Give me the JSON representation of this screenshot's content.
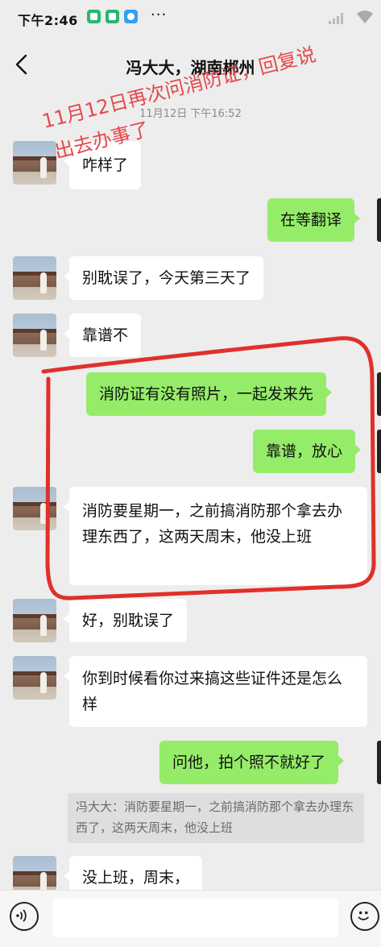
{
  "status_bar": {
    "time": "下午2:46",
    "more": "···"
  },
  "header": {
    "title": "冯大大，湖南郴州",
    "back_icon": "chevron-left-icon"
  },
  "timestamp": "11月12日 下午16:52",
  "annotation": {
    "line1": "11月12日再次问消防证，回复说",
    "line2": "出去办事了",
    "color": "#e5484d"
  },
  "messages": [
    {
      "side": "in",
      "text": "咋样了"
    },
    {
      "side": "out",
      "text": "在等翻译"
    },
    {
      "side": "in",
      "text": "别耽误了，今天第三天了"
    },
    {
      "side": "in",
      "text": "靠谱不"
    },
    {
      "side": "out",
      "text": "消防证有没有照片，一起发来先"
    },
    {
      "side": "out",
      "text": "靠谱，放心"
    },
    {
      "side": "in",
      "text": "消防要星期一，之前搞消防那个拿去办理东西了，这两天周末，他没上班"
    },
    {
      "side": "in",
      "text": "好，别耽误了"
    },
    {
      "side": "in",
      "text": "你到时候看你过来搞这些证件还是怎么样"
    },
    {
      "side": "out",
      "text": "问他，拍个照不就好了"
    },
    {
      "side": "in",
      "text": "没上班，周末，"
    }
  ],
  "quote": {
    "text": "冯大大：消防要星期一，之前搞消防那个拿去办理东西了，这两天周末，他没上班"
  },
  "input_bar": {
    "placeholder": "",
    "voice_icon": "voice-icon",
    "emoji_icon": "emoji-icon"
  },
  "colors": {
    "incoming_bubble": "#ffffff",
    "outgoing_bubble": "#95ec69",
    "background": "#ededed",
    "highlight": "#e0302b"
  }
}
